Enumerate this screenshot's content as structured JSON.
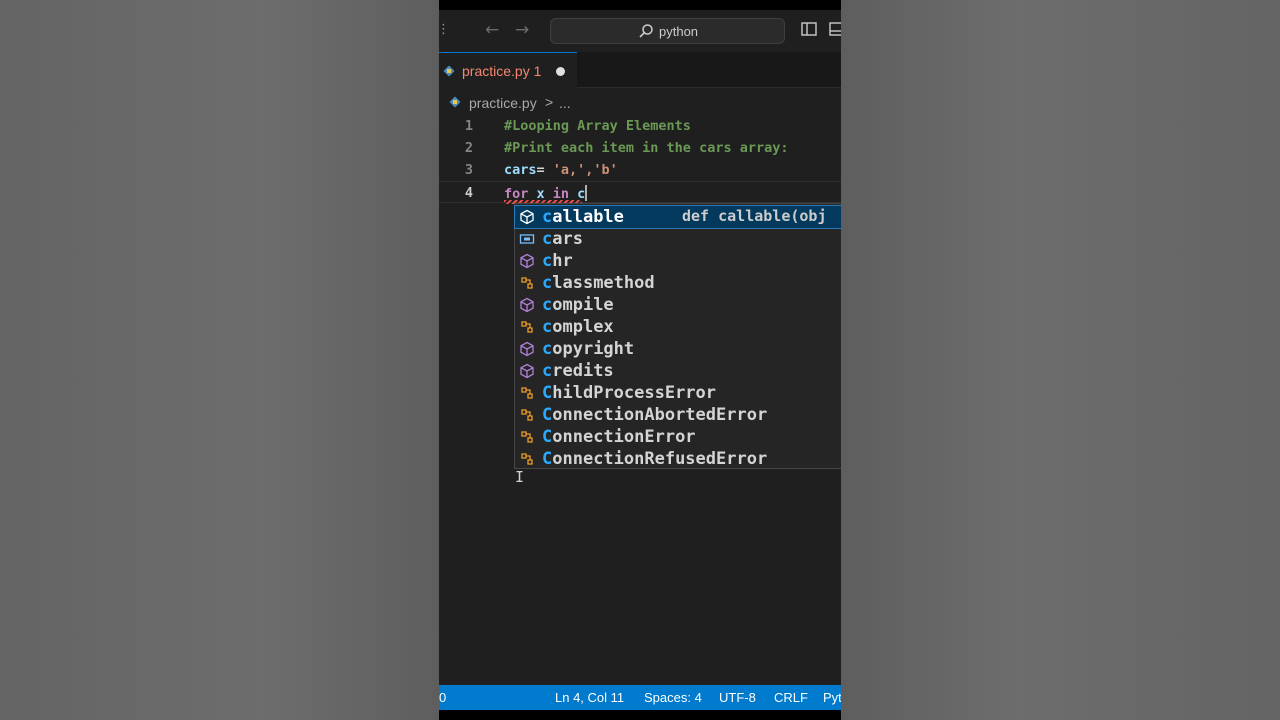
{
  "titlebar": {
    "search_text": "python"
  },
  "tab": {
    "label": "practice.py 1"
  },
  "breadcrumb": {
    "file": "practice.py",
    "separator": ">",
    "more": "..."
  },
  "editor": {
    "lines": [
      {
        "number": "1",
        "text": "#Looping Array Elements"
      },
      {
        "number": "2",
        "text": "#Print each item in the cars array:"
      },
      {
        "number": "3",
        "var": "cars",
        "op": "= ",
        "str": "'a,','b'"
      },
      {
        "number": "4",
        "kw1": "for",
        "var1": " x ",
        "kw2": "in",
        "var2": " c"
      }
    ]
  },
  "suggestions": {
    "items": [
      {
        "match": "c",
        "rest": "allable",
        "icon": "cube-icon",
        "detail": "def callable(obj"
      },
      {
        "match": "c",
        "rest": "ars",
        "icon": "variable-icon"
      },
      {
        "match": "c",
        "rest": "hr",
        "icon": "cube-icon"
      },
      {
        "match": "c",
        "rest": "lassmethod",
        "icon": "class-icon"
      },
      {
        "match": "c",
        "rest": "ompile",
        "icon": "cube-icon"
      },
      {
        "match": "c",
        "rest": "omplex",
        "icon": "class-icon"
      },
      {
        "match": "c",
        "rest": "opyright",
        "icon": "cube-icon"
      },
      {
        "match": "c",
        "rest": "redits",
        "icon": "cube-icon"
      },
      {
        "match": "C",
        "rest": "hildProcessError",
        "icon": "class-icon"
      },
      {
        "match": "C",
        "rest": "onnectionAbortedError",
        "icon": "class-icon"
      },
      {
        "match": "C",
        "rest": "onnectionError",
        "icon": "class-icon"
      },
      {
        "match": "C",
        "rest": "onnectionRefusedError",
        "icon": "class-icon"
      }
    ]
  },
  "statusbar": {
    "problems": "0",
    "position": "Ln 4, Col 11",
    "spaces": "Spaces: 4",
    "encoding": "UTF-8",
    "eol": "CRLF",
    "language": "Pyt"
  },
  "colors": {
    "accent": "#007acc",
    "comment": "#6a9955",
    "match_highlight": "#2aaaff",
    "error_tab": "#f48771"
  }
}
